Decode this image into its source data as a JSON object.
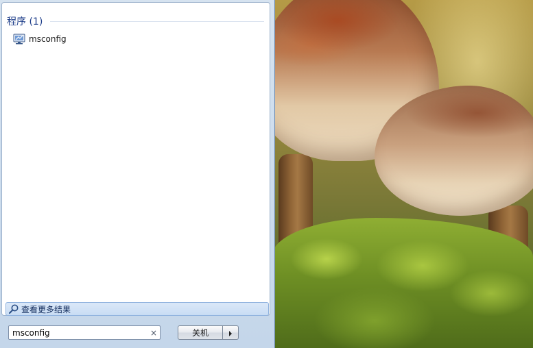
{
  "start_menu": {
    "group_header": "程序 (1)",
    "results": [
      {
        "label": "msconfig",
        "icon": "system-configuration-icon"
      }
    ],
    "more_results_label": "查看更多结果",
    "search": {
      "value": "msconfig",
      "clear_glyph": "×"
    },
    "shutdown_label": "关机"
  },
  "colors": {
    "group_header": "#1e3e8a",
    "panel_background": "#c4d6ea",
    "highlight": "#c8dcf4"
  }
}
